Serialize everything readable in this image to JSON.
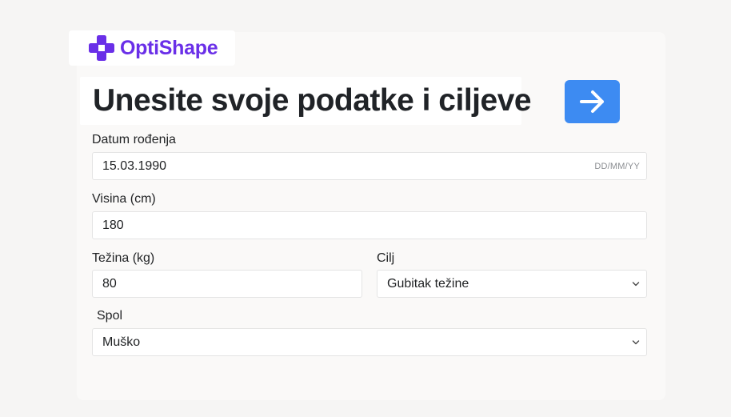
{
  "brand": {
    "name": "OptiShape",
    "color": "#6a2fe8",
    "icon": "plus-cross-icon"
  },
  "header": {
    "title": "Unesite svoje podatke i ciljeve",
    "next_icon": "arrow-right-icon",
    "accent": "#3d8bf2"
  },
  "form": {
    "birthdate": {
      "label": "Datum rođenja",
      "value": "15.03.1990",
      "format_hint": "DD/MM/YY"
    },
    "height": {
      "label": "Visina (cm)",
      "value": "180"
    },
    "weight": {
      "label": "Težina (kg)",
      "value": "80"
    },
    "goal": {
      "label": "Cilj",
      "value": "Gubitak težine"
    },
    "gender": {
      "label": "Spol",
      "value": "Muško"
    }
  }
}
